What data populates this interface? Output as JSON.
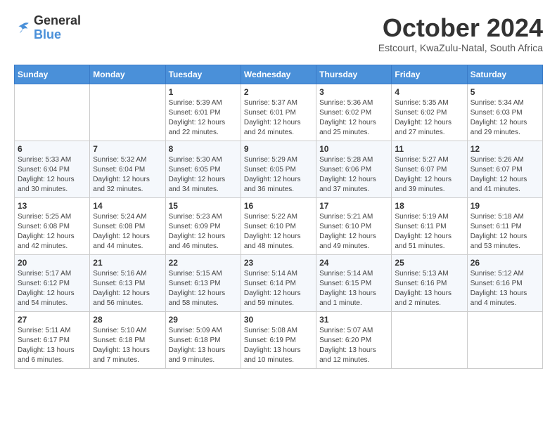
{
  "header": {
    "logo_line1": "General",
    "logo_line2": "Blue",
    "month_title": "October 2024",
    "subtitle": "Estcourt, KwaZulu-Natal, South Africa"
  },
  "days_of_week": [
    "Sunday",
    "Monday",
    "Tuesday",
    "Wednesday",
    "Thursday",
    "Friday",
    "Saturday"
  ],
  "weeks": [
    [
      {
        "day": "",
        "info": ""
      },
      {
        "day": "",
        "info": ""
      },
      {
        "day": "1",
        "info": "Sunrise: 5:39 AM\nSunset: 6:01 PM\nDaylight: 12 hours and 22 minutes."
      },
      {
        "day": "2",
        "info": "Sunrise: 5:37 AM\nSunset: 6:01 PM\nDaylight: 12 hours and 24 minutes."
      },
      {
        "day": "3",
        "info": "Sunrise: 5:36 AM\nSunset: 6:02 PM\nDaylight: 12 hours and 25 minutes."
      },
      {
        "day": "4",
        "info": "Sunrise: 5:35 AM\nSunset: 6:02 PM\nDaylight: 12 hours and 27 minutes."
      },
      {
        "day": "5",
        "info": "Sunrise: 5:34 AM\nSunset: 6:03 PM\nDaylight: 12 hours and 29 minutes."
      }
    ],
    [
      {
        "day": "6",
        "info": "Sunrise: 5:33 AM\nSunset: 6:04 PM\nDaylight: 12 hours and 30 minutes."
      },
      {
        "day": "7",
        "info": "Sunrise: 5:32 AM\nSunset: 6:04 PM\nDaylight: 12 hours and 32 minutes."
      },
      {
        "day": "8",
        "info": "Sunrise: 5:30 AM\nSunset: 6:05 PM\nDaylight: 12 hours and 34 minutes."
      },
      {
        "day": "9",
        "info": "Sunrise: 5:29 AM\nSunset: 6:05 PM\nDaylight: 12 hours and 36 minutes."
      },
      {
        "day": "10",
        "info": "Sunrise: 5:28 AM\nSunset: 6:06 PM\nDaylight: 12 hours and 37 minutes."
      },
      {
        "day": "11",
        "info": "Sunrise: 5:27 AM\nSunset: 6:07 PM\nDaylight: 12 hours and 39 minutes."
      },
      {
        "day": "12",
        "info": "Sunrise: 5:26 AM\nSunset: 6:07 PM\nDaylight: 12 hours and 41 minutes."
      }
    ],
    [
      {
        "day": "13",
        "info": "Sunrise: 5:25 AM\nSunset: 6:08 PM\nDaylight: 12 hours and 42 minutes."
      },
      {
        "day": "14",
        "info": "Sunrise: 5:24 AM\nSunset: 6:08 PM\nDaylight: 12 hours and 44 minutes."
      },
      {
        "day": "15",
        "info": "Sunrise: 5:23 AM\nSunset: 6:09 PM\nDaylight: 12 hours and 46 minutes."
      },
      {
        "day": "16",
        "info": "Sunrise: 5:22 AM\nSunset: 6:10 PM\nDaylight: 12 hours and 48 minutes."
      },
      {
        "day": "17",
        "info": "Sunrise: 5:21 AM\nSunset: 6:10 PM\nDaylight: 12 hours and 49 minutes."
      },
      {
        "day": "18",
        "info": "Sunrise: 5:19 AM\nSunset: 6:11 PM\nDaylight: 12 hours and 51 minutes."
      },
      {
        "day": "19",
        "info": "Sunrise: 5:18 AM\nSunset: 6:11 PM\nDaylight: 12 hours and 53 minutes."
      }
    ],
    [
      {
        "day": "20",
        "info": "Sunrise: 5:17 AM\nSunset: 6:12 PM\nDaylight: 12 hours and 54 minutes."
      },
      {
        "day": "21",
        "info": "Sunrise: 5:16 AM\nSunset: 6:13 PM\nDaylight: 12 hours and 56 minutes."
      },
      {
        "day": "22",
        "info": "Sunrise: 5:15 AM\nSunset: 6:13 PM\nDaylight: 12 hours and 58 minutes."
      },
      {
        "day": "23",
        "info": "Sunrise: 5:14 AM\nSunset: 6:14 PM\nDaylight: 12 hours and 59 minutes."
      },
      {
        "day": "24",
        "info": "Sunrise: 5:14 AM\nSunset: 6:15 PM\nDaylight: 13 hours and 1 minute."
      },
      {
        "day": "25",
        "info": "Sunrise: 5:13 AM\nSunset: 6:16 PM\nDaylight: 13 hours and 2 minutes."
      },
      {
        "day": "26",
        "info": "Sunrise: 5:12 AM\nSunset: 6:16 PM\nDaylight: 13 hours and 4 minutes."
      }
    ],
    [
      {
        "day": "27",
        "info": "Sunrise: 5:11 AM\nSunset: 6:17 PM\nDaylight: 13 hours and 6 minutes."
      },
      {
        "day": "28",
        "info": "Sunrise: 5:10 AM\nSunset: 6:18 PM\nDaylight: 13 hours and 7 minutes."
      },
      {
        "day": "29",
        "info": "Sunrise: 5:09 AM\nSunset: 6:18 PM\nDaylight: 13 hours and 9 minutes."
      },
      {
        "day": "30",
        "info": "Sunrise: 5:08 AM\nSunset: 6:19 PM\nDaylight: 13 hours and 10 minutes."
      },
      {
        "day": "31",
        "info": "Sunrise: 5:07 AM\nSunset: 6:20 PM\nDaylight: 13 hours and 12 minutes."
      },
      {
        "day": "",
        "info": ""
      },
      {
        "day": "",
        "info": ""
      }
    ]
  ]
}
